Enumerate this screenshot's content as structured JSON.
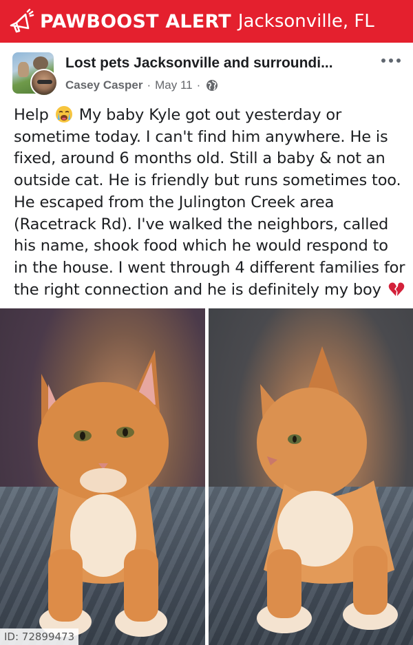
{
  "alert_bar": {
    "title": "PAWBOOST ALERT",
    "location": "Jacksonville, FL",
    "icon": "megaphone-icon",
    "background_color": "#e4202e"
  },
  "post": {
    "group_name": "Lost pets Jacksonville and surroundi...",
    "author": "Casey Casper",
    "date": "May 11",
    "separator": "·",
    "privacy_icon": "globe-icon",
    "more_icon": "more-options-icon",
    "text_lines": [
      {
        "before": "Help ",
        "emoji": "crying-face-emoji",
        "after": " My baby Kyle got out yesterday or"
      },
      {
        "before": "sometime today. I can't find him anywhere. He is"
      },
      {
        "before": "fixed, around 6 months old. Still a baby & not an"
      },
      {
        "before": "outside cat. He is friendly but runs sometimes too."
      },
      {
        "before": "He escaped from the Julington Creek area"
      },
      {
        "before": "(Racetrack Rd). I've walked the neighbors, called"
      },
      {
        "before": "his name, shook food which he would respond to"
      },
      {
        "before": "in the house. I went through 4 different families for"
      },
      {
        "before": "the right connection and he is definitely my boy ",
        "emoji": "broken-heart-emoji"
      }
    ]
  },
  "photos": [
    {
      "subject": "orange tabby cat facing forward on gray blanket"
    },
    {
      "subject": "orange tabby cat in profile on gray blanket"
    }
  ],
  "photo_id_label": "ID: 72899473"
}
